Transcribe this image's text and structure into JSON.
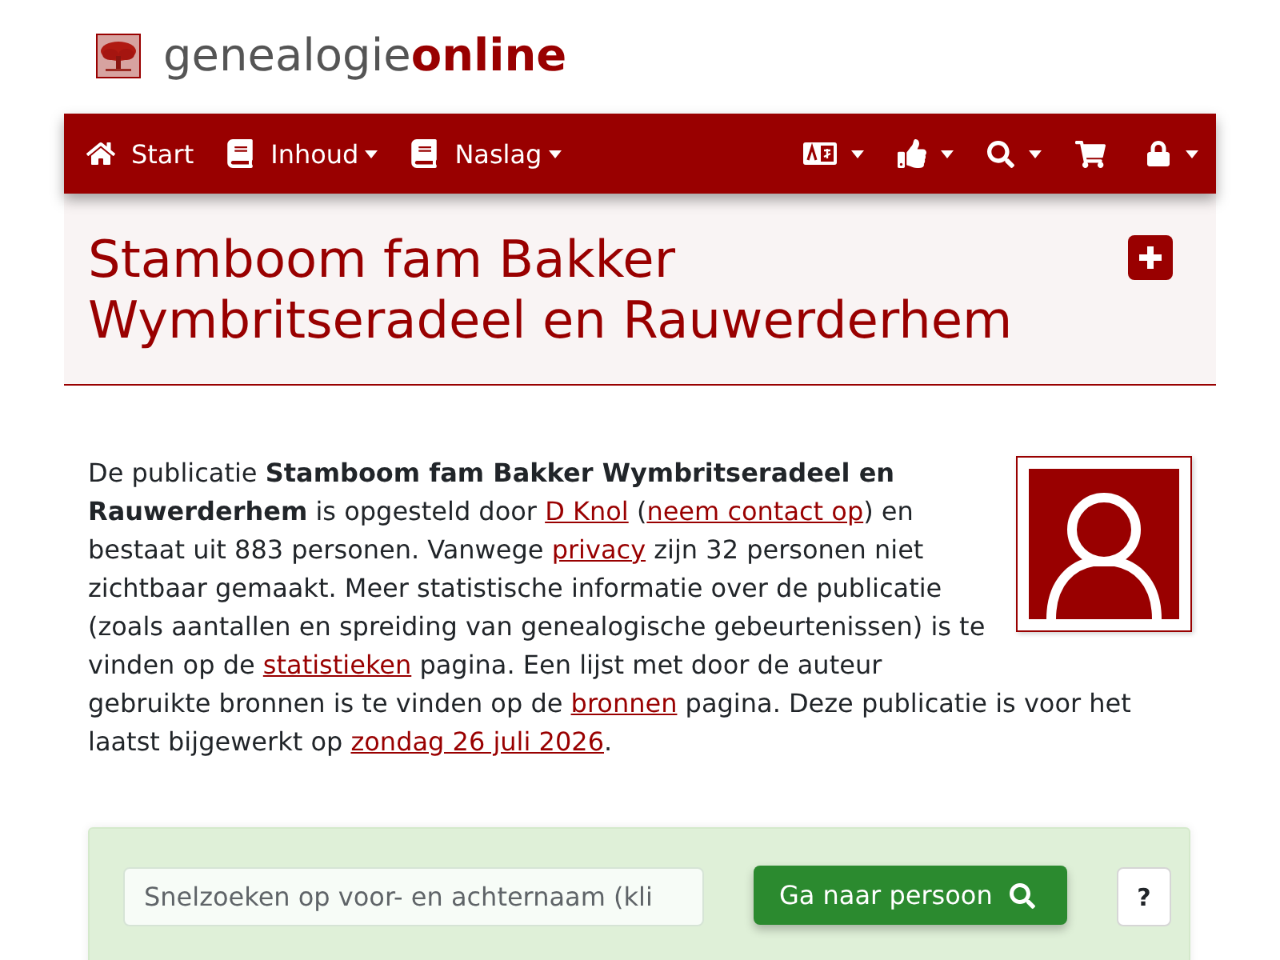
{
  "logo": {
    "text": "genealogie",
    "accent": "online"
  },
  "navbar": {
    "left": [
      {
        "kind": "home",
        "label": "Start",
        "dropdown": false
      },
      {
        "kind": "book",
        "label": "Inhoud",
        "dropdown": true
      },
      {
        "kind": "book",
        "label": "Naslag",
        "dropdown": true
      }
    ],
    "right": [
      {
        "kind": "language",
        "dropdown": true
      },
      {
        "kind": "like",
        "dropdown": true
      },
      {
        "kind": "search",
        "dropdown": true
      },
      {
        "kind": "cart",
        "dropdown": false
      },
      {
        "kind": "lock",
        "dropdown": true
      }
    ]
  },
  "header": {
    "title": "Stamboom fam Bakker Wymbritseradeel en Rauwerderhem"
  },
  "intro": {
    "segments": [
      {
        "kind": "text",
        "text": "De publicatie **Stamboom fam Bakker Wymbritseradeel en Rauwerderhem** is opgesteld door "
      },
      {
        "kind": "link",
        "text": "D Knol"
      },
      {
        "kind": "text",
        "text": " ("
      },
      {
        "kind": "link",
        "text": "neem contact op"
      },
      {
        "kind": "text",
        "text": ") en bestaat uit 883 personen. Vanwege "
      },
      {
        "kind": "link",
        "text": "privacy"
      },
      {
        "kind": "text",
        "text": " zijn 32 personen niet zichtbaar gemaakt. Meer statistische informatie over de publicatie (zoals aantallen en spreiding van genealogische gebeurtenissen) is te vinden op de "
      },
      {
        "kind": "link",
        "text": "statistieken"
      },
      {
        "kind": "text",
        "text": " pagina. Een lijst met door de auteur gebruikte bronnen is te vinden op de "
      },
      {
        "kind": "link",
        "text": "bronnen"
      },
      {
        "kind": "text",
        "text": " pagina. Deze publicatie is voor het laatst bijgewerkt op "
      },
      {
        "kind": "link",
        "text": "zondag 26 juli 2026"
      },
      {
        "kind": "text",
        "text": "."
      }
    ]
  },
  "quick_search": {
    "placeholder": "Snelzoeken op voor- en achternaam (kli",
    "button": "Ga naar persoon",
    "help": "?"
  }
}
